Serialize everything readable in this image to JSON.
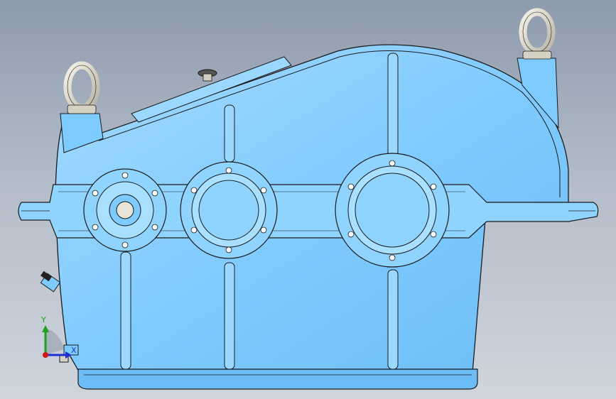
{
  "viewport": {
    "background_top": "#8e9bad",
    "background_bottom": "#d0d5dd"
  },
  "model": {
    "body_color": "#7ecbff",
    "edge_color": "#1b1b1b",
    "shade_color": "#5aaee6",
    "highlight_color": "#b8e4ff",
    "hardware_color": "#e5e3d6"
  },
  "triad": {
    "x_label": "X",
    "y_label": "Y",
    "x_color": "#2030d0",
    "y_color": "#1fa01f",
    "z_color": "#d01818"
  }
}
